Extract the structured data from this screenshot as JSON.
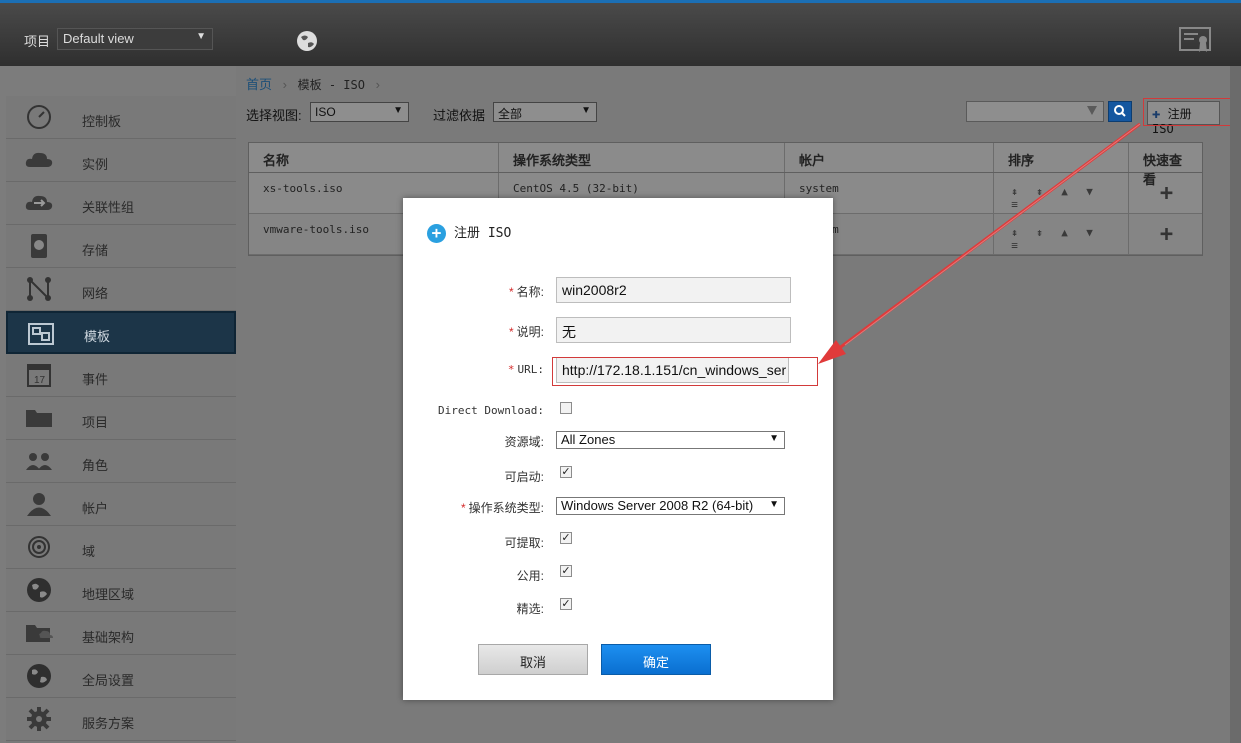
{
  "header": {
    "project_label": "项目",
    "project_select_value": "Default view"
  },
  "sidebar": {
    "items": [
      {
        "label": "控制板",
        "icon": "dashboard-icon"
      },
      {
        "label": "实例",
        "icon": "cloud-icon"
      },
      {
        "label": "关联性组",
        "icon": "affinity-cloud-icon"
      },
      {
        "label": "存储",
        "icon": "storage-icon"
      },
      {
        "label": "网络",
        "icon": "network-icon"
      },
      {
        "label": "模板",
        "icon": "template-icon",
        "active": true
      },
      {
        "label": "事件",
        "icon": "calendar-icon"
      },
      {
        "label": "项目",
        "icon": "folder-icon"
      },
      {
        "label": "角色",
        "icon": "roles-icon"
      },
      {
        "label": "帐户",
        "icon": "user-icon"
      },
      {
        "label": "域",
        "icon": "domain-icon"
      },
      {
        "label": "地理区域",
        "icon": "globe-icon"
      },
      {
        "label": "基础架构",
        "icon": "infrastructure-icon"
      },
      {
        "label": "全局设置",
        "icon": "settings-globe-icon"
      },
      {
        "label": "服务方案",
        "icon": "gear-icon"
      }
    ]
  },
  "breadcrumb": {
    "home": "首页",
    "current": "模板 - ISO"
  },
  "toolbar": {
    "view_label": "选择视图:",
    "view_value": "ISO",
    "filter_label": "过滤依据",
    "filter_value": "全部",
    "register_label": "注册 ISO"
  },
  "grid": {
    "columns": [
      "名称",
      "操作系统类型",
      "帐户",
      "排序",
      "快速查看"
    ],
    "rows": [
      {
        "name": "xs-tools.iso",
        "os": "CentOS 4.5 (32-bit)",
        "account": "system"
      },
      {
        "name": "vmware-tools.iso",
        "os": "",
        "account": "system"
      }
    ]
  },
  "dialog": {
    "title": "注册 ISO",
    "fields": {
      "name_label": "名称:",
      "name_value": "win2008r2",
      "desc_label": "说明:",
      "desc_value": "无",
      "url_label": "URL:",
      "url_value": "http://172.18.1.151/cn_windows_ser",
      "direct_label": "Direct Download:",
      "direct_checked": false,
      "zone_label": "资源域:",
      "zone_value": "All Zones",
      "bootable_label": "可启动:",
      "bootable_checked": true,
      "os_label": "操作系统类型:",
      "os_value": "Windows Server 2008 R2 (64-bit)",
      "extractable_label": "可提取:",
      "extractable_checked": true,
      "public_label": "公用:",
      "public_checked": true,
      "featured_label": "精选:",
      "featured_checked": true
    },
    "cancel_label": "取消",
    "ok_label": "确定"
  },
  "colors": {
    "accent": "#1b6fb5",
    "ok_button": "#1d8ff0",
    "annotation_red": "#e03a3a",
    "active_nav": "#1c3548"
  }
}
